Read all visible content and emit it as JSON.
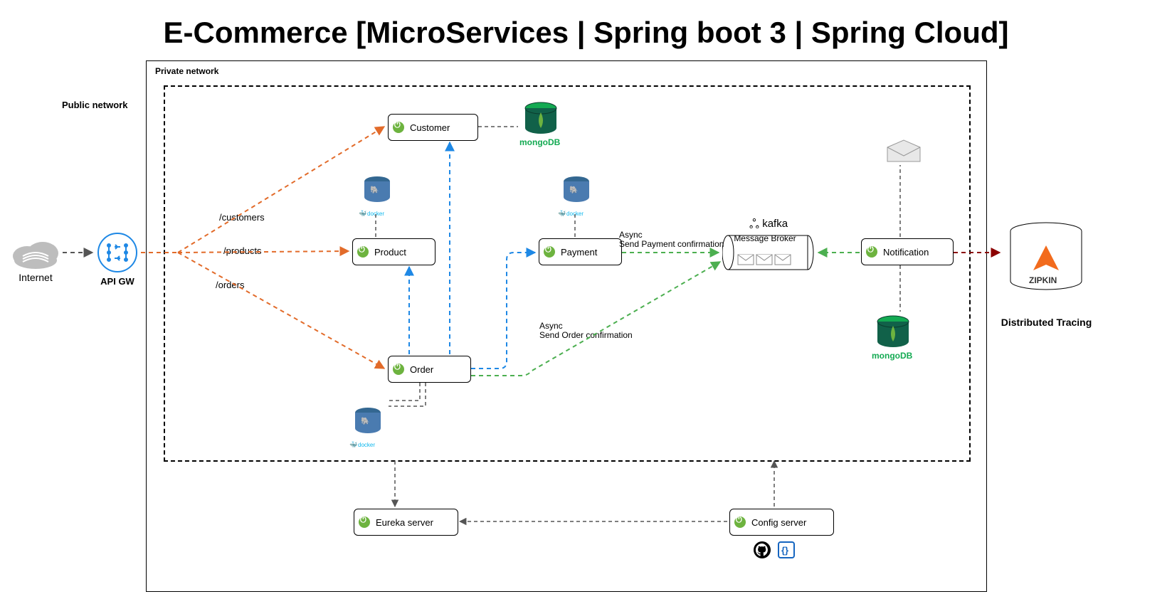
{
  "title": "E-Commerce [MicroServices | Spring boot 3 | Spring Cloud]",
  "labels": {
    "public_network": "Public network",
    "private_network": "Private network",
    "internet": "Internet",
    "api_gw": "API GW",
    "distributed_tracing": "Distributed Tracing"
  },
  "routes": {
    "customers": "/customers",
    "products": "/products",
    "orders": "/orders"
  },
  "services": {
    "customer": "Customer",
    "product": "Product",
    "payment": "Payment",
    "order": "Order",
    "notification": "Notification",
    "eureka": "Eureka server",
    "config": "Config server"
  },
  "broker": {
    "kafka": "kafka",
    "message_broker": "Message Broker"
  },
  "async": {
    "payment_line1": "Async",
    "payment_line2": "Send Payment confirmation",
    "order_line1": "Async",
    "order_line2": "Send Order confirmation"
  },
  "logos": {
    "mongo": "mongoDB",
    "zipkin": "ZIPKIN",
    "docker": "docker"
  },
  "colors": {
    "orange": "#e26b2a",
    "blue": "#1e88e5",
    "green": "#4caf50",
    "darkred": "#8b0000",
    "gray": "#888888"
  }
}
